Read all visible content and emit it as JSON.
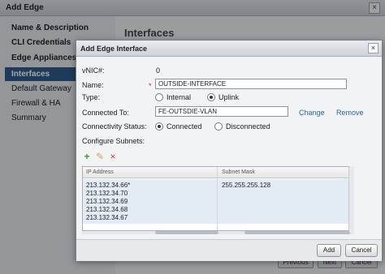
{
  "wizard": {
    "title": "Add Edge",
    "close_glyph": "×",
    "steps": [
      {
        "label": "Name & Description"
      },
      {
        "label": "CLI Credentials"
      },
      {
        "label": "Edge Appliances"
      },
      {
        "label": "Interfaces"
      },
      {
        "label": "Default Gateway"
      },
      {
        "label": "Firewall & HA"
      },
      {
        "label": "Summary"
      }
    ],
    "section_heading": "Interfaces",
    "buttons": {
      "previous": "Previous",
      "next": "Next",
      "cancel": "Cancel"
    }
  },
  "dialog": {
    "title": "Add Edge Interface",
    "close_glyph": "×",
    "vnic_label": "vNIC#:",
    "vnic_value": "0",
    "name_label": "Name:",
    "required_marker": "*",
    "name_value": "OUTSIDE-INTERFACE",
    "type_label": "Type:",
    "type_options": [
      {
        "label": "Internal",
        "selected": false
      },
      {
        "label": "Uplink",
        "selected": true
      }
    ],
    "connected_to_label": "Connected To:",
    "connected_to_value": "FE-OUTSDIE-VLAN",
    "change_link": "Change",
    "remove_link": "Remove",
    "connectivity_label": "Connectivity Status:",
    "connectivity_options": [
      {
        "label": "Connected",
        "selected": true
      },
      {
        "label": "Disconnected",
        "selected": false
      }
    ],
    "subnets_label": "Configure Subnets:",
    "toolbar": {
      "add_icon": "+",
      "edit_icon": "✎",
      "delete_icon": "×"
    },
    "grid": {
      "columns": [
        "IP Address",
        "Subnet Mask"
      ],
      "ip_addresses": [
        "213.132.34.66*",
        "213.132.34.70",
        "213.132.34.69",
        "213.132.34.68",
        "213.132.34.67"
      ],
      "subnet_mask": "255.255.255.128"
    },
    "buttons": {
      "add": "Add",
      "cancel": "Cancel"
    }
  }
}
